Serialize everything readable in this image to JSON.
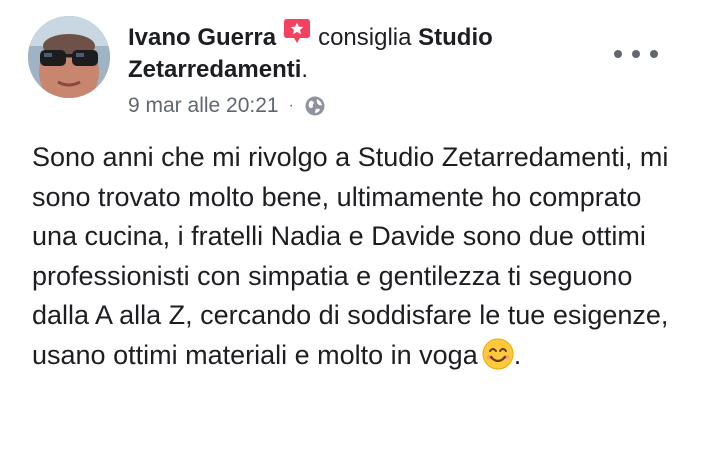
{
  "post": {
    "author_name": "Ivano Guerra",
    "action_verb": "consiglia",
    "page_name": "Studio Zetarredamenti",
    "title_end": ".",
    "timestamp": "9 mar alle 20:21",
    "separator": "·",
    "audience_icon": "globe-icon",
    "badge_icon": "recommendation-icon",
    "body_text": "Sono anni che mi rivolgo a Studio Zetarredamenti, mi sono trovato molto bene, ultimamente ho comprato una cucina, i fratelli Nadia e Davide sono due ottimi professionisti con simpatia e gentilezza ti seguono dalla A alla Z, cercando di soddisfare le tue esigenze, usano ottimi materiali e molto in voga",
    "emoji": "smiling-face-icon",
    "body_end": "."
  },
  "colors": {
    "badge": "#f3425f",
    "meta_text": "#606770",
    "text": "#1c1e21"
  }
}
